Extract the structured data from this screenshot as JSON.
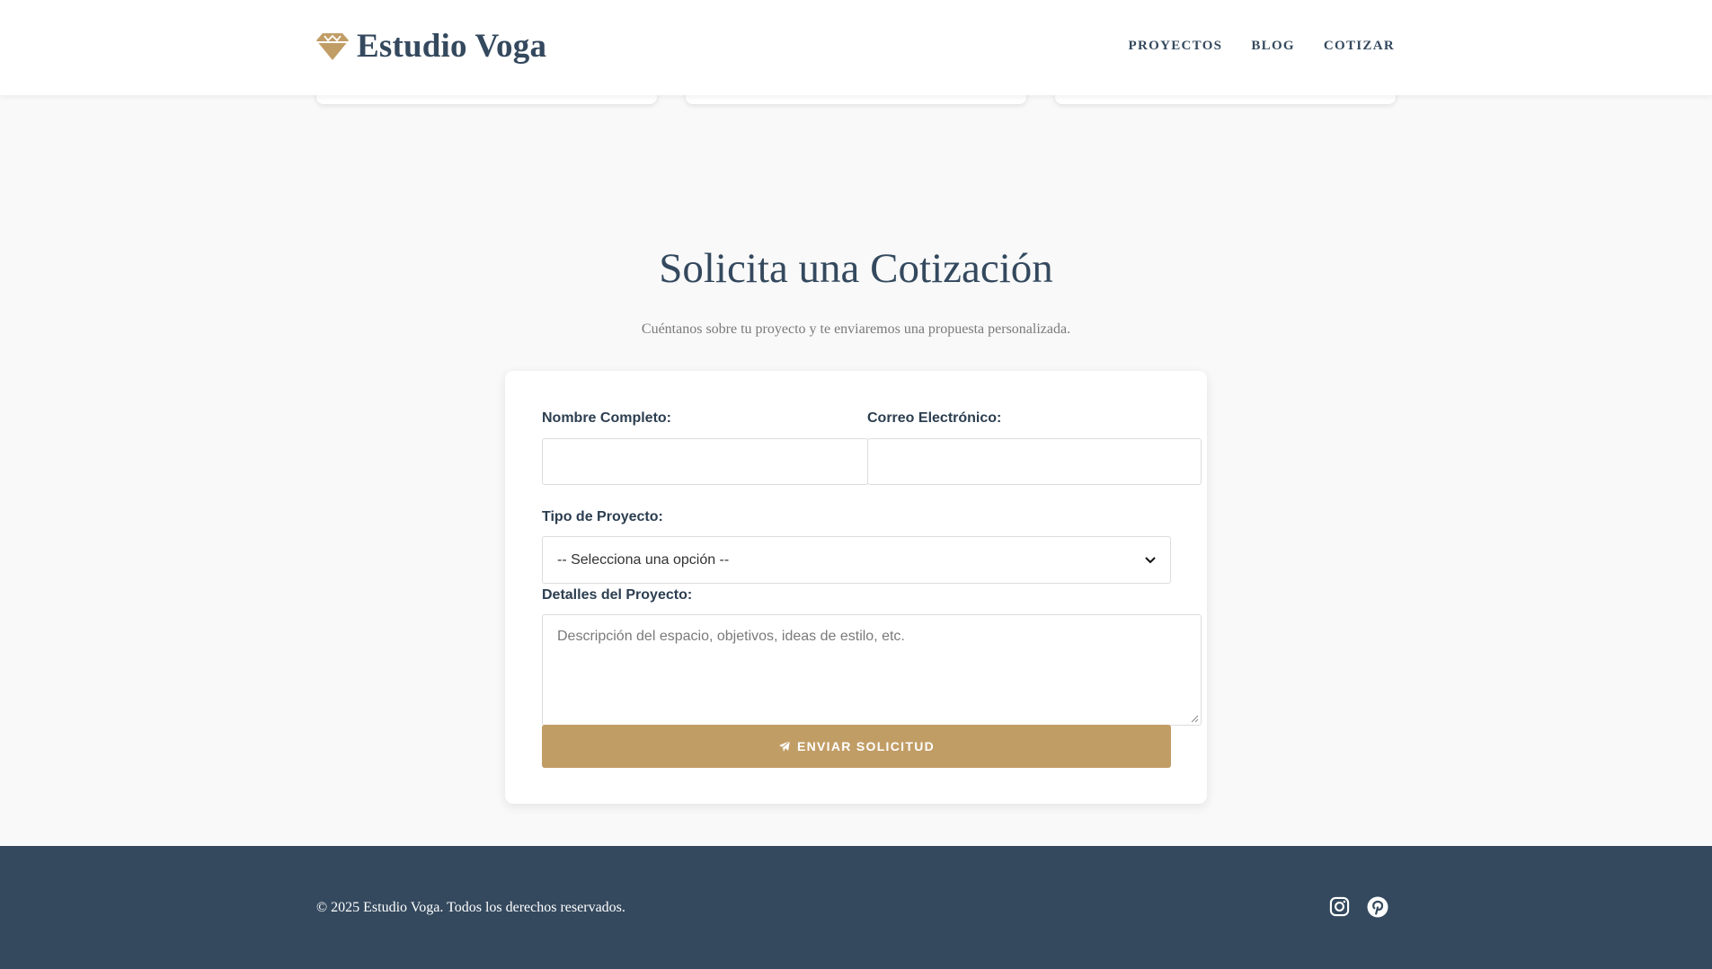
{
  "header": {
    "brand_name": "Estudio Voga",
    "logo_icon": "diamond-icon",
    "nav": [
      {
        "label": "PROYECTOS"
      },
      {
        "label": "BLOG"
      },
      {
        "label": "COTIZAR"
      }
    ]
  },
  "quote": {
    "title": "Solicita una Cotización",
    "subtitle": "Cuéntanos sobre tu proyecto y te enviaremos una propuesta personalizada.",
    "form": {
      "name_label": "Nombre Completo:",
      "name_value": "",
      "email_label": "Correo Electrónico:",
      "email_value": "",
      "project_type_label": "Tipo de Proyecto:",
      "project_type_selected": "-- Selecciona una opción --",
      "details_label": "Detalles del Proyecto:",
      "details_placeholder": "Descripción del espacio, objetivos, ideas de estilo, etc.",
      "submit_label": "ENVIAR SOLICITUD",
      "submit_icon": "paper-plane-icon"
    }
  },
  "footer": {
    "copyright": "© 2025 Estudio Voga. Todos los derechos reservados.",
    "social": [
      {
        "icon": "instagram-icon"
      },
      {
        "icon": "pinterest-icon"
      }
    ]
  },
  "colors": {
    "accent": "#c19d66",
    "primary": "#34495e",
    "background": "#f9f9f9"
  }
}
